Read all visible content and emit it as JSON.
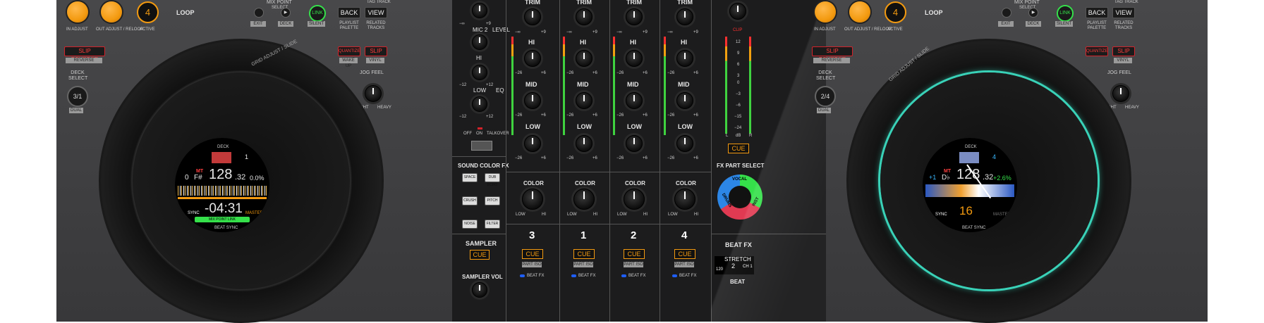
{
  "colors": {
    "accent": "#f39a10",
    "red": "#d3222a",
    "green": "#35e04a",
    "jog_glow": "#39d2b8"
  },
  "left_deck": {
    "loop_label": "LOOP",
    "pad4_label": "4",
    "pad_captions": [
      "IN ADJUST",
      "OUT ADJUST / RELOOP",
      "ACTIVE"
    ],
    "mix_point": "MIX POINT",
    "select": "SELECT",
    "link": "LINK",
    "exit": "EXIT",
    "deck": "DECK",
    "silent": "SILENT",
    "tag_track": "TAG TRACK",
    "back": "BACK",
    "view": "VIEW",
    "playlist_palette": "PLAYLIST PALETTE",
    "related_tracks": "RELATED TRACKS",
    "slip_reverse": "SLIP REVERSE",
    "reverse": "REVERSE",
    "quantize": "QUANTIZE",
    "slip": "SLIP",
    "wake_up": "WAKE UP",
    "vinyl": "VINYL",
    "deck_select": "DECK SELECT",
    "deck_value": "3/1",
    "dual": "DUAL",
    "jog_feel": "JOG FEEL",
    "light": "LIGHT",
    "heavy": "HEAVY",
    "grid_adjust": "GRID ADJUST / SLIDE",
    "screen": {
      "deck_label": "DECK",
      "deck_num": "1",
      "key_prefix": "0",
      "key": "F#",
      "mt": "MT",
      "bpm": "128",
      "bpm_dec": ".32",
      "pitch": "0.0%",
      "time": "-04:31",
      "mix_point_link": "MIX POINT LINK",
      "sync": "SYNC",
      "master": "MASTER",
      "beat_sync": "BEAT SYNC"
    }
  },
  "right_deck": {
    "loop_label": "LOOP",
    "pad4_label": "4",
    "pad_captions": [
      "IN ADJUST",
      "OUT ADJUST / RELOOP",
      "ACTIVE"
    ],
    "mix_point": "MIX POINT",
    "select": "SELECT",
    "link": "LINK",
    "exit": "EXIT",
    "deck": "DECK",
    "silent": "SILENT",
    "tag_track": "TAG TRACK",
    "back": "BACK",
    "view": "VIEW",
    "playlist_palette": "PLAYLIST PALETTE",
    "related_tracks": "RELATED TRACKS",
    "slip_reverse": "SLIP REVERSE",
    "reverse": "REVERSE",
    "quantize": "QUANTIZE",
    "slip": "SLIP",
    "vinyl": "VINYL",
    "deck_select": "DECK SELECT",
    "deck_value": "2/4",
    "dual": "DUAL",
    "jog_feel": "JOG FEEL",
    "light": "LIGHT",
    "heavy": "HEAVY",
    "grid_adjust": "GRID ADJUST / SLIDE",
    "screen": {
      "deck_label": "DECK",
      "deck_num": "4",
      "key_prefix": "+1",
      "key": "D♭",
      "mt": "MT",
      "bpm": "128",
      "bpm_dec": ".32",
      "pitch": "+2.6%",
      "loop_beats": "16",
      "sync": "SYNC",
      "master": "MASTER",
      "beat_sync": "BEAT SYNC"
    }
  },
  "mixer": {
    "mic2": "MIC 2",
    "level": "LEVEL",
    "hi": "HI",
    "low": "LOW",
    "eq": "EQ",
    "off": "OFF",
    "on": "ON",
    "talkover": "TALKOVER",
    "trim": "TRIM",
    "mid": "MID",
    "color": "COLOR",
    "minus_inf": "−∞",
    "plus9": "+9",
    "minus26": "−26",
    "plus6": "+6",
    "minus12": "−12",
    "plus12": "+12",
    "lo_word": "LOW",
    "hi_word": "HI",
    "sound_color_fx": "SOUND COLOR FX",
    "fx_buttons": [
      "SPACE",
      "DUB ECHO",
      "CRUSH",
      "PITCH",
      "NOISE",
      "FILTER"
    ],
    "sampler": "SAMPLER",
    "cue": "CUE",
    "sampler_vol": "SAMPLER VOL",
    "channels": [
      "3",
      "1",
      "2",
      "4"
    ],
    "part_iso": "PART ISO",
    "beat_fx_small": "BEAT FX",
    "fx_part_select": "FX PART SELECT",
    "vocal": "VOCAL",
    "drums": "DRUMS",
    "inst": "INST",
    "clip": "CLIP",
    "meter_scale": [
      "12",
      "9",
      "6",
      "3",
      "0",
      "−3",
      "−6",
      "−15",
      "−24"
    ],
    "meter_l": "L",
    "meter_db": "dB",
    "meter_r": "R",
    "master_cue": "CUE",
    "beat_fx": "BEAT FX",
    "beat_fx_display": {
      "effect": "STRETCH",
      "value": "2",
      "channel": "CH 1",
      "bpm": "120"
    },
    "beat": "BEAT"
  }
}
